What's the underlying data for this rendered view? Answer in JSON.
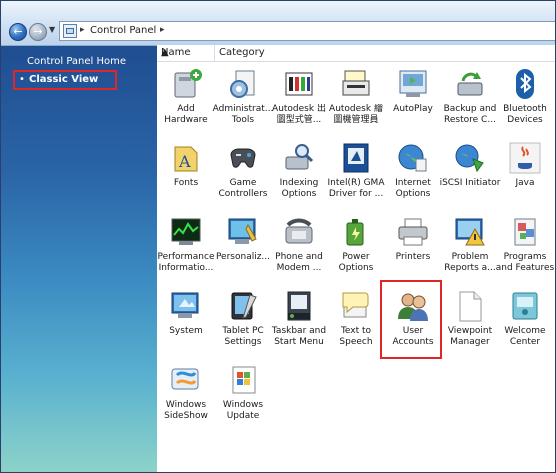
{
  "address_bar": {
    "breadcrumb": "Control Panel"
  },
  "left_pane": {
    "home_link": "Control Panel Home",
    "classic_view": "Classic View"
  },
  "columns": {
    "name": "Name",
    "category": "Category"
  },
  "items": [
    {
      "label": "Add\nHardware",
      "icon": "add-hardware-icon"
    },
    {
      "label": "Administrat...\nTools",
      "icon": "administrative-tools-icon"
    },
    {
      "label": "Autodesk 出\n圖型式管...",
      "icon": "autodesk-plot-style-icon"
    },
    {
      "label": "Autodesk 繪\n圖機管理員",
      "icon": "autodesk-plotter-manager-icon"
    },
    {
      "label": "AutoPlay",
      "icon": "autoplay-icon"
    },
    {
      "label": "Backup and\nRestore C...",
      "icon": "backup-restore-icon"
    },
    {
      "label": "Bluetooth\nDevices",
      "icon": "bluetooth-icon"
    },
    {
      "label": "Fonts",
      "icon": "fonts-icon"
    },
    {
      "label": "Game\nControllers",
      "icon": "game-controllers-icon"
    },
    {
      "label": "Indexing\nOptions",
      "icon": "indexing-options-icon"
    },
    {
      "label": "Intel(R) GMA\nDriver for ...",
      "icon": "intel-gma-icon"
    },
    {
      "label": "Internet\nOptions",
      "icon": "internet-options-icon"
    },
    {
      "label": "iSCSI Initiator",
      "icon": "iscsi-initiator-icon"
    },
    {
      "label": "Java",
      "icon": "java-icon"
    },
    {
      "label": "Performance\nInformatio...",
      "icon": "performance-icon"
    },
    {
      "label": "Personaliz...",
      "icon": "personalization-icon"
    },
    {
      "label": "Phone and\nModem ...",
      "icon": "phone-modem-icon"
    },
    {
      "label": "Power\nOptions",
      "icon": "power-options-icon"
    },
    {
      "label": "Printers",
      "icon": "printers-icon"
    },
    {
      "label": "Problem\nReports a...",
      "icon": "problem-reports-icon"
    },
    {
      "label": "Programs\nand Features",
      "icon": "programs-features-icon"
    },
    {
      "label": "System",
      "icon": "system-icon"
    },
    {
      "label": "Tablet PC\nSettings",
      "icon": "tablet-pc-icon"
    },
    {
      "label": "Taskbar and\nStart Menu",
      "icon": "taskbar-icon"
    },
    {
      "label": "Text to\nSpeech",
      "icon": "text-to-speech-icon"
    },
    {
      "label": "User\nAccounts",
      "icon": "user-accounts-icon"
    },
    {
      "label": "Viewpoint\nManager",
      "icon": "viewpoint-manager-icon"
    },
    {
      "label": "Welcome\nCenter",
      "icon": "welcome-center-icon"
    },
    {
      "label": "Windows\nSideShow",
      "icon": "windows-sideshow-icon"
    },
    {
      "label": "Windows\nUpdate",
      "icon": "windows-update-icon"
    }
  ],
  "colors": {
    "highlight": "#e22626",
    "pane_top": "#1f4e91",
    "pane_bottom": "#8ed3c9"
  }
}
